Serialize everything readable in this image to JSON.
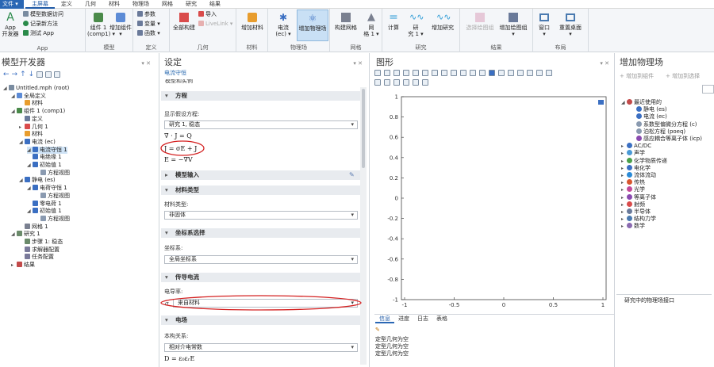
{
  "menubar": {
    "file": "文件 ▾",
    "tabs": [
      "主屏幕",
      "定义",
      "几何",
      "材料",
      "物理场",
      "网格",
      "研究",
      "结果"
    ]
  },
  "ribbon": {
    "app": {
      "big": "App\n开发器",
      "items": [
        "模型数据访问",
        "记录新方法",
        "测试 App"
      ],
      "label": "App"
    },
    "model": {
      "comp": "组件 1\n(comp1) ▾",
      "add_comp": "增加组件\n▾",
      "label": "模型"
    },
    "definitions": {
      "items": [
        "参数",
        "变量 ▾",
        "函数 ▾"
      ],
      "label": "定义"
    },
    "geometry": {
      "build_all": "全部构建",
      "import": "导入",
      "livelink": "LiveLink ▾",
      "label": "几何"
    },
    "materials": {
      "add_material": "增加材料",
      "label": "材料"
    },
    "physics": {
      "es": "电流\n(ec) ▾",
      "add_physics": "增加物理场",
      "label": "物理场"
    },
    "mesh": {
      "build_mesh": "构建网格",
      "mesh1": "网\n格 1 ▾",
      "label": "网格"
    },
    "study": {
      "compute": "计算",
      "study1": "研\n究 1 ▾",
      "add_study": "增加研究",
      "label": "研究"
    },
    "results": {
      "select_dataset": "选择绘图组",
      "add_plot": "增加绘图组\n▾",
      "label": "结果"
    },
    "layout": {
      "window": "窗口\n▾",
      "reset": "重置桌面\n▾",
      "label": "布局"
    }
  },
  "model_builder": {
    "title": "模型开发器",
    "tree": [
      {
        "label": "Untitled.mph (root)",
        "italic_part": "(root)",
        "level": 0,
        "icon": "file-icon",
        "color": "#7a8ca0"
      },
      {
        "label": "全局定义",
        "level": 1,
        "icon": "globe-icon",
        "color": "#5c8bd6"
      },
      {
        "label": "材料",
        "level": 2,
        "icon": "materials-icon",
        "color": "#e89d2e"
      },
      {
        "label": "组件 1 (comp1)",
        "level": 1,
        "icon": "component-icon",
        "color": "#4a8a4a"
      },
      {
        "label": "定义",
        "level": 2,
        "icon": "definitions-icon",
        "color": "#6a7a9a"
      },
      {
        "label": "几何 1",
        "level": 2,
        "icon": "geometry-icon",
        "color": "#d94b4b"
      },
      {
        "label": "材料",
        "level": 2,
        "icon": "materials-icon",
        "color": "#e89d2e"
      },
      {
        "label": "电流 (ec)",
        "level": 2,
        "icon": "current-icon",
        "color": "#3b6fc2"
      },
      {
        "label": "电流守恒 1",
        "level": 3,
        "icon": "node-icon",
        "color": "#3b6fc2",
        "selected": true
      },
      {
        "label": "电绝缘 1",
        "level": 3,
        "icon": "node-icon",
        "color": "#3b6fc2"
      },
      {
        "label": "初始值 1",
        "level": 3,
        "icon": "node-icon",
        "color": "#3b6fc2"
      },
      {
        "label": "方程视图",
        "level": 4,
        "icon": "equation-view-icon",
        "color": "#8a9ab0"
      },
      {
        "label": "静电 (es)",
        "level": 2,
        "icon": "electrostatics-icon",
        "color": "#3b6fc2"
      },
      {
        "label": "电荷守恒 1",
        "level": 3,
        "icon": "node-icon",
        "color": "#3b6fc2"
      },
      {
        "label": "方程视图",
        "level": 4,
        "icon": "equation-view-icon",
        "color": "#8a9ab0"
      },
      {
        "label": "零电荷 1",
        "level": 3,
        "icon": "node-icon",
        "color": "#3b6fc2"
      },
      {
        "label": "初始值 1",
        "level": 3,
        "icon": "node-icon",
        "color": "#3b6fc2"
      },
      {
        "label": "方程视图",
        "level": 4,
        "icon": "equation-view-icon",
        "color": "#8a9ab0"
      },
      {
        "label": "网格 1",
        "level": 2,
        "icon": "mesh-icon",
        "color": "#7a8090"
      },
      {
        "label": "研究 1",
        "level": 1,
        "icon": "study-icon",
        "color": "#6a8a6a"
      },
      {
        "label": "步骤 1: 稳态",
        "level": 2,
        "icon": "step-icon",
        "color": "#6a8a6a"
      },
      {
        "label": "求解器配置",
        "level": 2,
        "icon": "solver-icon",
        "color": "#7a7a9a"
      },
      {
        "label": "任务配置",
        "level": 2,
        "icon": "jobs-icon",
        "color": "#7a7a9a"
      },
      {
        "label": "结果",
        "level": 1,
        "icon": "results-icon",
        "color": "#c24a4a"
      }
    ]
  },
  "settings": {
    "title": "设定",
    "subtitle": "电流守恒",
    "cut_section": "模型和实例",
    "sections": {
      "equation": "方程",
      "model_input": "模型输入",
      "material_type": "材料类型",
      "coord_system": "坐标系选择",
      "conduction": "传导电流",
      "field": "电场"
    },
    "show_equation_label": "显示假设方程:",
    "show_equation_value": "研究 1, 稳态",
    "equations": [
      "∇ · J = Q",
      "J = σE + J",
      "E = −∇V"
    ],
    "material_type_label": "材料类型:",
    "material_type_value": "非固体",
    "coord_label": "坐标系:",
    "coord_value": "全局坐标系",
    "conductivity_label": "电导率:",
    "sigma": "σ",
    "conductivity_value": "来自材料",
    "constitutive_label": "本构关系:",
    "constitutive_value": "相对介电常数",
    "field_eq": "D = ε₀εᵣE"
  },
  "graphics": {
    "title": "图形",
    "y_ticks": [
      "1",
      "0.8",
      "0.6",
      "0.4",
      "0.2",
      "0",
      "-0.2",
      "-0.4",
      "-0.6",
      "-0.8",
      "-1"
    ],
    "x_ticks": [
      "-1",
      "-0.5",
      "0",
      "0.5",
      "1"
    ],
    "bottom_tabs": [
      "信息",
      "进度",
      "日志",
      "表格"
    ],
    "messages": [
      "定型几何为空",
      "定型几何为空",
      "定型几何为空"
    ]
  },
  "add_physics": {
    "title": "增加物理场",
    "add_to_component": "增加到组件",
    "add_to_selection": "增加到选择",
    "tree": [
      {
        "label": "最近使用的",
        "level": 0,
        "icon": "recent-icon",
        "color": "#c24a4a",
        "expanded": true
      },
      {
        "label": "静电 (es)",
        "level": 1,
        "icon": "electrostatics-icon",
        "color": "#3b6fc2"
      },
      {
        "label": "电流 (ec)",
        "level": 1,
        "icon": "current-icon",
        "color": "#3b6fc2"
      },
      {
        "label": "系数型偏微分方程 (c)",
        "level": 1,
        "icon": "pde-icon",
        "color": "#8a9ab0"
      },
      {
        "label": "泊松方程 (poeq)",
        "level": 1,
        "icon": "pde-icon",
        "color": "#8a9ab0"
      },
      {
        "label": "感应耦合等离子体 (icp)",
        "level": 1,
        "icon": "plasma-icon",
        "color": "#8a4ab0"
      },
      {
        "label": "AC/DC",
        "level": 0,
        "icon": "acdc-icon",
        "color": "#3b6fc2"
      },
      {
        "label": "声学",
        "level": 0,
        "icon": "acoustics-icon",
        "color": "#4a9ad6"
      },
      {
        "label": "化学物质传递",
        "level": 0,
        "icon": "chemical-icon",
        "color": "#4aa04a"
      },
      {
        "label": "电化学",
        "level": 0,
        "icon": "electrochem-icon",
        "color": "#3b6fc2"
      },
      {
        "label": "流体流动",
        "level": 0,
        "icon": "fluid-icon",
        "color": "#2a8ad6"
      },
      {
        "label": "传热",
        "level": 0,
        "icon": "heat-icon",
        "color": "#d9562e"
      },
      {
        "label": "光学",
        "level": 0,
        "icon": "optics-icon",
        "color": "#c24a9a"
      },
      {
        "label": "等离子体",
        "level": 0,
        "icon": "plasma-icon",
        "color": "#8a4ab0"
      },
      {
        "label": "射频",
        "level": 0,
        "icon": "rf-icon",
        "color": "#d94b4b"
      },
      {
        "label": "半导体",
        "level": 0,
        "icon": "semiconductor-icon",
        "color": "#6a7a9a"
      },
      {
        "label": "结构力学",
        "level": 0,
        "icon": "structural-icon",
        "color": "#4a7ab0"
      },
      {
        "label": "数学",
        "level": 0,
        "icon": "math-icon",
        "color": "#8a6ab0"
      }
    ],
    "footer": "研究中的物理场接口"
  }
}
